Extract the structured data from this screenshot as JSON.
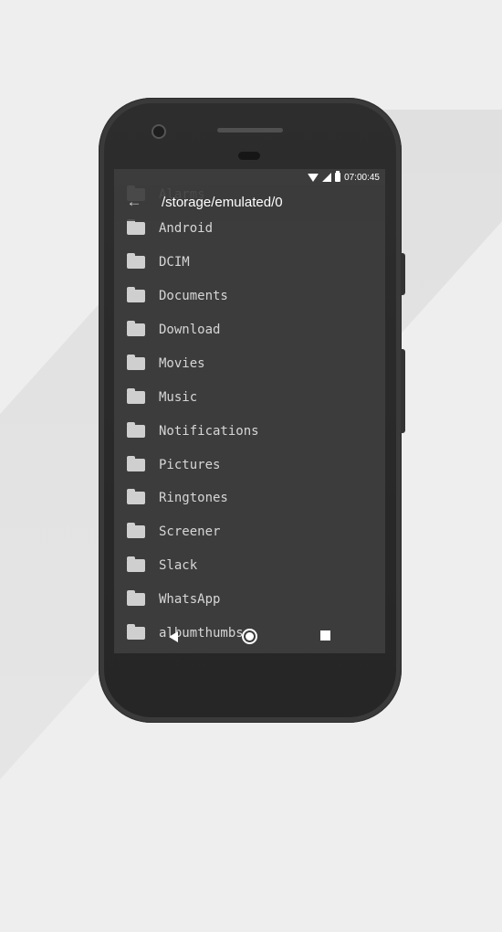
{
  "status_bar": {
    "time": "07:00:45",
    "icons": [
      "wifi-icon",
      "signal-icon",
      "battery-icon"
    ]
  },
  "toolbar": {
    "back_icon": "arrow-back-icon",
    "back_glyph": "←",
    "path": "/storage/emulated/0"
  },
  "folders": [
    {
      "label": "Alarms",
      "icon": "folder-icon"
    },
    {
      "label": "Android",
      "icon": "folder-icon"
    },
    {
      "label": "DCIM",
      "icon": "folder-icon"
    },
    {
      "label": "Documents",
      "icon": "folder-icon"
    },
    {
      "label": "Download",
      "icon": "folder-icon"
    },
    {
      "label": "Movies",
      "icon": "folder-icon"
    },
    {
      "label": "Music",
      "icon": "folder-icon"
    },
    {
      "label": "Notifications",
      "icon": "folder-icon"
    },
    {
      "label": "Pictures",
      "icon": "folder-icon"
    },
    {
      "label": "Ringtones",
      "icon": "folder-icon"
    },
    {
      "label": "Screener",
      "icon": "folder-icon"
    },
    {
      "label": "Slack",
      "icon": "folder-icon"
    },
    {
      "label": "WhatsApp",
      "icon": "folder-icon"
    },
    {
      "label": "albumthumbs",
      "icon": "folder-icon"
    }
  ],
  "nav_bar": {
    "icons": [
      "nav-back-icon",
      "nav-home-icon",
      "nav-recents-icon"
    ]
  },
  "colors": {
    "background": "#eeeeee",
    "screen": "#3c3c3c",
    "text": "#d6d6d6",
    "folder": "#cfcfcf"
  }
}
